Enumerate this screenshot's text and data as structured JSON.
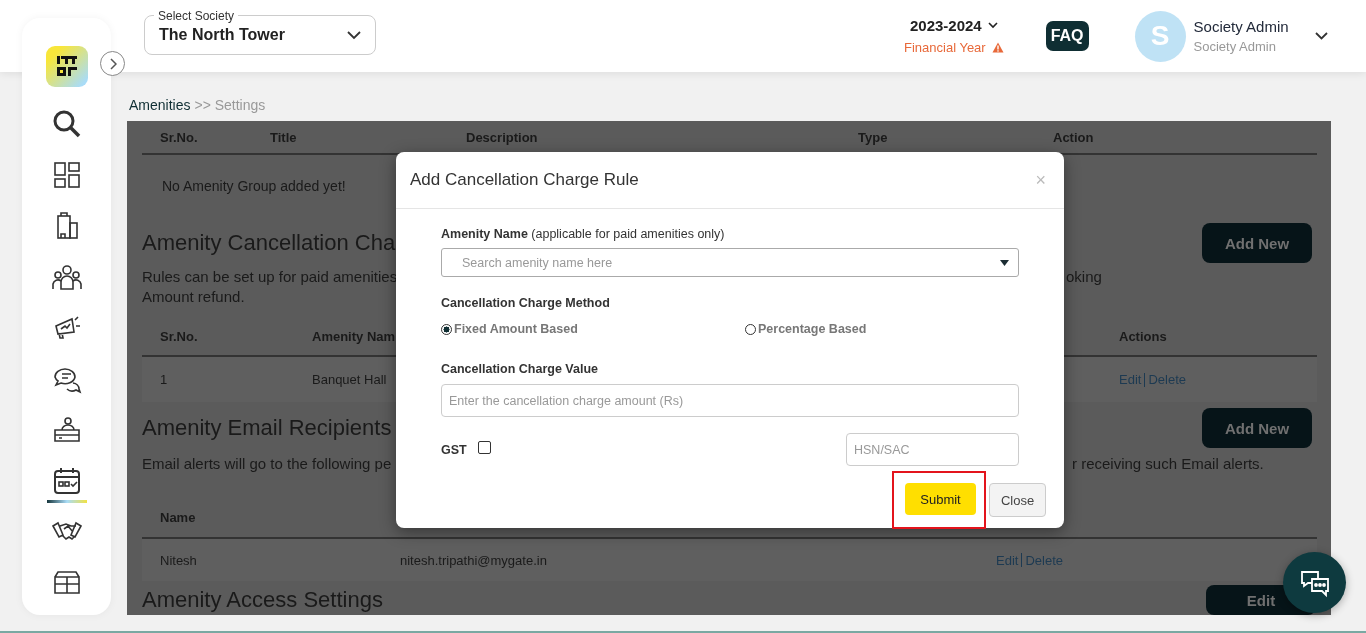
{
  "header": {
    "society_select": {
      "label": "Select Society",
      "value": "The North Tower"
    },
    "financial_year": {
      "value": "2023-2024",
      "label": "Financial Year",
      "warning": true
    },
    "faq": "FAQ",
    "user": {
      "initial": "S",
      "name": "Society Admin",
      "role": "Society Admin"
    }
  },
  "sidebar": {
    "items": [
      {
        "kind": "search",
        "selected": false
      },
      {
        "kind": "grid",
        "selected": false
      },
      {
        "kind": "building",
        "selected": false
      },
      {
        "kind": "people",
        "selected": false
      },
      {
        "kind": "megaphone",
        "selected": false
      },
      {
        "kind": "chat",
        "selected": false
      },
      {
        "kind": "desk",
        "selected": false
      },
      {
        "kind": "calendar",
        "selected": true
      },
      {
        "kind": "handshake",
        "selected": false
      },
      {
        "kind": "box",
        "selected": false
      }
    ]
  },
  "breadcrumb": {
    "link": "Amenities",
    "current": ">> Settings"
  },
  "background": {
    "groups_table": {
      "columns": [
        "Sr.No.",
        "Title",
        "Description",
        "Type",
        "Action"
      ],
      "empty": "No Amenity Group added yet!"
    },
    "cancellation": {
      "heading": "Amenity Cancellation Cha",
      "button": "Add New",
      "text_left": "Rules can be set up for paid amenities",
      "text_left_2": "Amount refund.",
      "text_right": "oking",
      "columns": [
        "Sr.No.",
        "Amenity Nam",
        "Actions"
      ],
      "rows": [
        {
          "sr": "1",
          "name": "Banquet Hall",
          "edit": "Edit",
          "delete": "Delete"
        }
      ]
    },
    "email": {
      "heading": "Amenity Email Recipients",
      "button": "Add New",
      "text_left": "Email alerts will go to the following pe",
      "text_right": "r receiving such Email alerts.",
      "columns": [
        "Name"
      ],
      "rows": [
        {
          "name": "Nitesh",
          "email": "nitesh.tripathi@mygate.in",
          "edit": "Edit",
          "delete": "Delete"
        }
      ]
    },
    "access": {
      "heading": "Amenity Access Settings",
      "button": "Edit"
    }
  },
  "modal": {
    "title": "Add Cancellation Charge Rule",
    "close": "×",
    "amenity": {
      "label": "Amenity Name",
      "hint": " (applicable for paid amenities only)",
      "placeholder": "Search amenity name here"
    },
    "method": {
      "label": "Cancellation Charge Method",
      "options": [
        {
          "label": "Fixed Amount Based",
          "selected": true
        },
        {
          "label": "Percentage Based",
          "selected": false
        }
      ]
    },
    "value": {
      "label": "Cancellation Charge Value",
      "placeholder": "Enter the cancellation charge amount (Rs)"
    },
    "gst": {
      "label": "GST",
      "checked": false,
      "hsn_placeholder": "HSN/SAC"
    },
    "buttons": [
      {
        "label": "Submit",
        "kind": "primary",
        "highlighted": true
      },
      {
        "label": "Close",
        "kind": "secondary",
        "highlighted": false
      }
    ]
  }
}
